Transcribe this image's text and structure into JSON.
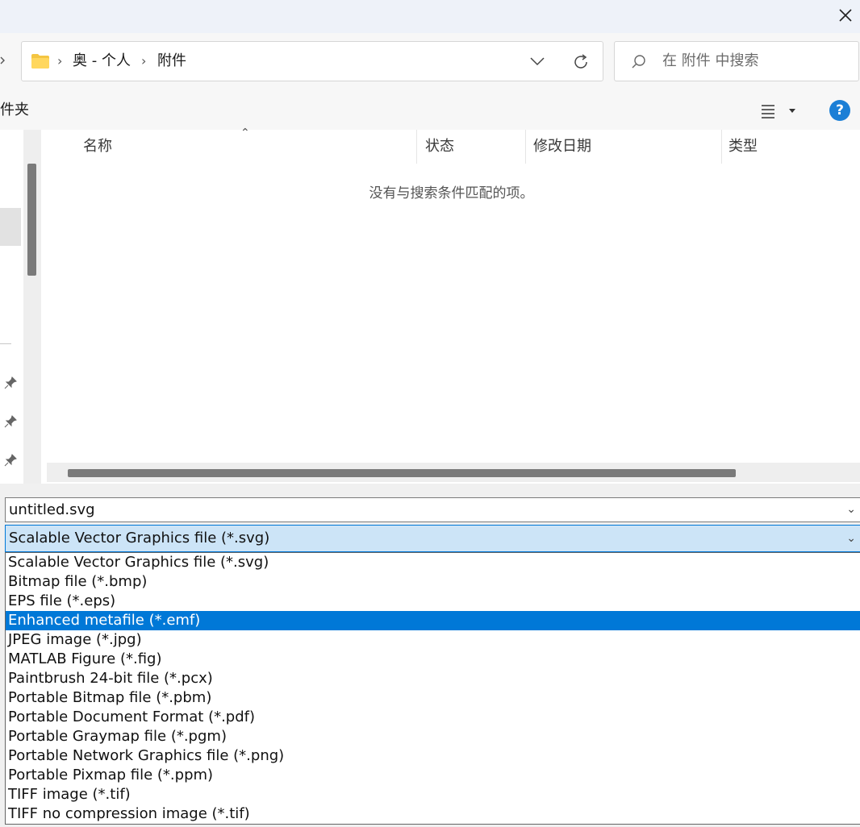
{
  "address": {
    "crumbs": [
      "奥 - 个人",
      "附件"
    ],
    "folder_icon": "folder-icon",
    "dropdown_icon": "chevron-down-icon",
    "refresh_icon": "refresh-icon"
  },
  "search": {
    "placeholder": "在 附件 中搜索",
    "icon": "search-icon"
  },
  "toolbar": {
    "label": "件夹",
    "view_icon": "view-menu-icon",
    "help_label": "?"
  },
  "columns": [
    "名称",
    "状态",
    "修改日期",
    "类型"
  ],
  "empty_message": "没有与搜索条件匹配的项。",
  "save": {
    "filename": "untitled.svg",
    "filetype_selected": "Scalable Vector Graphics file (*.svg)",
    "filetype_options": [
      "Scalable Vector Graphics file (*.svg)",
      "Bitmap file (*.bmp)",
      "EPS file (*.eps)",
      "Enhanced metafile (*.emf)",
      "JPEG image (*.jpg)",
      "MATLAB Figure (*.fig)",
      "Paintbrush 24-bit file (*.pcx)",
      "Portable Bitmap file (*.pbm)",
      "Portable Document Format (*.pdf)",
      "Portable Graymap file (*.pgm)",
      "Portable Network Graphics file (*.png)",
      "Portable Pixmap file (*.ppm)",
      "TIFF image (*.tif)",
      "TIFF no compression image (*.tif)"
    ],
    "highlighted_option": "Enhanced metafile (*.emf)"
  },
  "colors": {
    "accent": "#0078d7",
    "selected_field_bg": "#cce4f7",
    "help_bg": "#1b7fd6"
  }
}
